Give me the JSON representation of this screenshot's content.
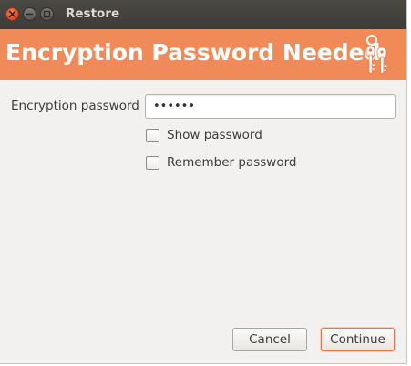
{
  "window": {
    "title": "Restore",
    "controls": {
      "close": "close-icon",
      "minimize": "minimize-icon",
      "maximize": "maximize-icon"
    }
  },
  "banner": {
    "title": "Encryption Password Needed",
    "icon": "keys-icon",
    "color": "#f08a59"
  },
  "form": {
    "password_label": "Encryption password",
    "password_value": "••••••",
    "show_password_label": "Show password",
    "show_password_checked": false,
    "remember_password_label": "Remember password",
    "remember_password_checked": false
  },
  "buttons": {
    "cancel_label": "Cancel",
    "continue_label": "Continue"
  }
}
